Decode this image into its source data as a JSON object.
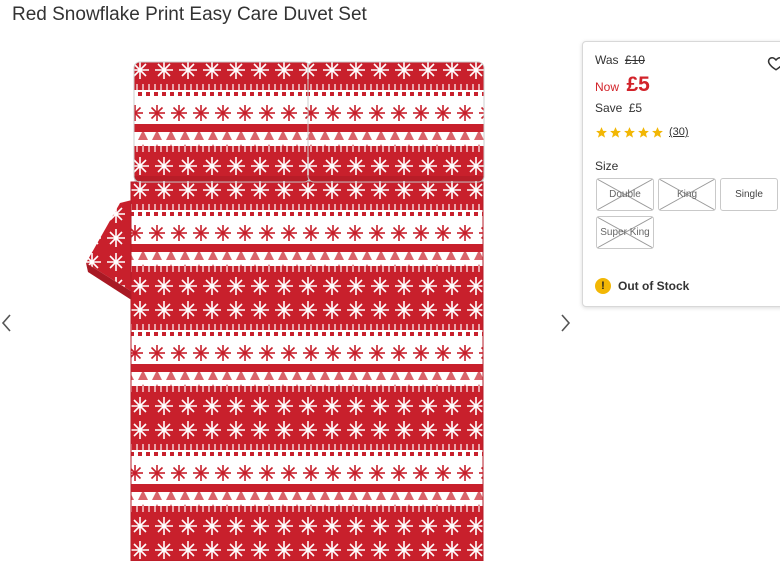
{
  "product": {
    "title": "Red Snowflake Print Easy Care Duvet Set"
  },
  "price": {
    "was_label": "Was",
    "was_value": "£10",
    "now_label": "Now",
    "now_value": "£5",
    "save_label": "Save",
    "save_value": "£5"
  },
  "rating": {
    "stars": 5,
    "reviews": "(30)"
  },
  "sizes": {
    "label": "Size",
    "options": [
      {
        "label": "Double",
        "available": false
      },
      {
        "label": "King",
        "available": false
      },
      {
        "label": "Single",
        "available": true
      },
      {
        "label": "Super King",
        "available": false
      }
    ]
  },
  "stock": {
    "status": "Out of Stock",
    "icon": "exclamation-icon"
  },
  "colors": {
    "accent_red": "#d2232a",
    "star": "#f2b705",
    "stock_icon": "#f2b705",
    "fabric_red": "#c8202c"
  },
  "icons": {
    "wishlist": "heart-icon",
    "prev": "chevron-left-icon",
    "next": "chevron-right-icon"
  }
}
